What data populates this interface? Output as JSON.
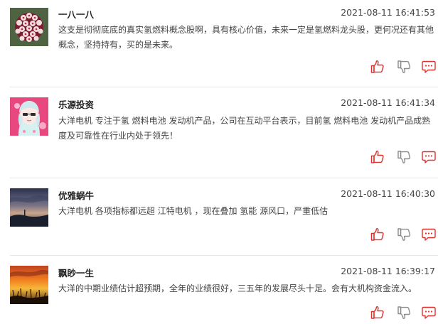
{
  "posts": [
    {
      "author": "一八一八",
      "time": "2021-08-11 16:41:53",
      "content": "这支是彻彻底底的真实氢燃料概念股啊，具有核心价值，未来一定是氢燃料龙头股，更何况还有其他概念，坚持持有，买的是未来。",
      "avatar": "flower-cluster-avatar"
    },
    {
      "author": "乐源投资",
      "time": "2021-08-11 16:41:34",
      "content": "大洋电机 专注于氢 燃料电池 发动机产品，公司在互动平台表示，目前氢 燃料电池 发动机产品成熟度及可靠性在行业内处于领先！",
      "avatar": "anime-character-avatar"
    },
    {
      "author": "优雅蜗牛",
      "time": "2021-08-11 16:40:30",
      "content": "大洋电机 各项指标都远超 江特电机 ，现在叠加 氢能 源风口，严重低估",
      "avatar": "dusk-sky-avatar"
    },
    {
      "author": "飘眇一生",
      "time": "2021-08-11 16:39:17",
      "content": "大洋的中期业绩估计超预期，全年的业绩很好，三五年的发展尽头十足。会有大机构资金流入。",
      "avatar": "sunset-grass-avatar"
    }
  ],
  "icons": {
    "like": "thumbs-up-icon",
    "dislike": "thumbs-down-icon",
    "comment": "comment-bubble-icon"
  },
  "colors": {
    "accent_red": "#e0302c",
    "icon_gray": "#8c8c8c",
    "divider": "#e6e6e6"
  }
}
